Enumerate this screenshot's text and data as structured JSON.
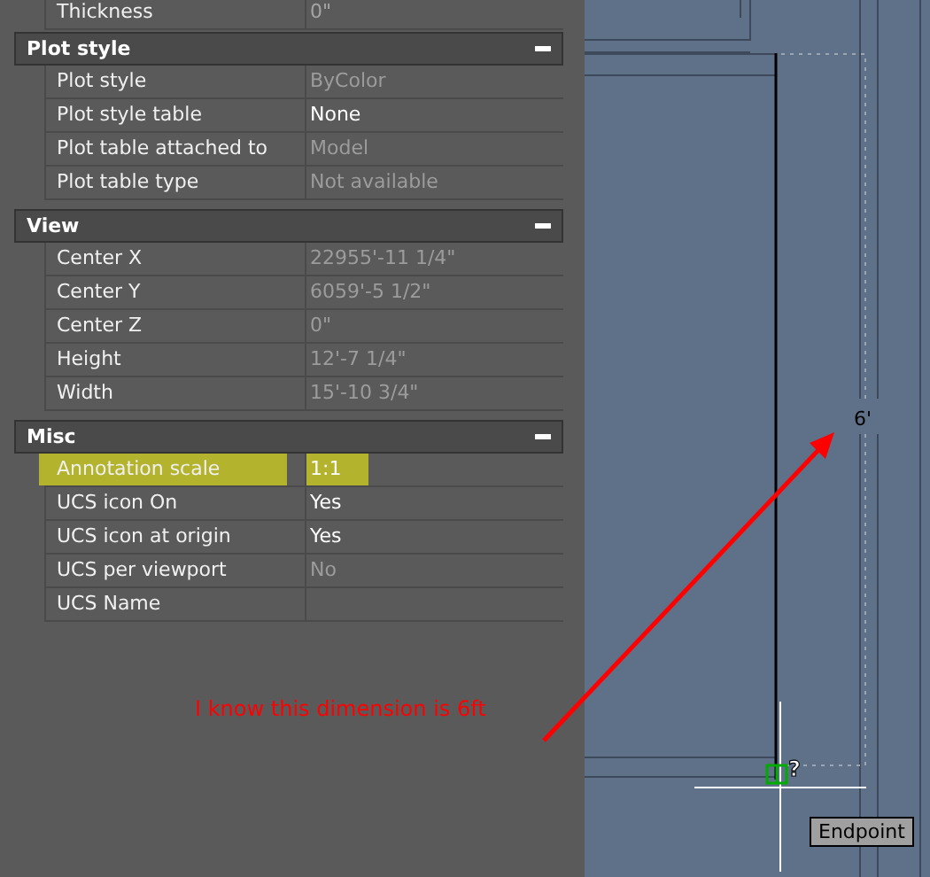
{
  "properties": {
    "partial_row": {
      "label": "Thickness",
      "value": "0\""
    },
    "sections": [
      {
        "title": "Plot style",
        "expanded": true,
        "rows": [
          {
            "label": "Plot style",
            "value": "ByColor",
            "read_only": true,
            "highlighted": false
          },
          {
            "label": "Plot style table",
            "value": "None",
            "read_only": false,
            "highlighted": false
          },
          {
            "label": "Plot table attached to",
            "value": "Model",
            "read_only": true,
            "highlighted": false
          },
          {
            "label": "Plot table type",
            "value": "Not available",
            "read_only": true,
            "highlighted": false
          }
        ]
      },
      {
        "title": "View",
        "expanded": true,
        "rows": [
          {
            "label": "Center X",
            "value": "22955'-11 1/4\"",
            "read_only": true,
            "highlighted": false
          },
          {
            "label": "Center Y",
            "value": "6059'-5 1/2\"",
            "read_only": true,
            "highlighted": false
          },
          {
            "label": "Center Z",
            "value": "0\"",
            "read_only": true,
            "highlighted": false
          },
          {
            "label": "Height",
            "value": "12'-7 1/4\"",
            "read_only": true,
            "highlighted": false
          },
          {
            "label": "Width",
            "value": "15'-10 3/4\"",
            "read_only": true,
            "highlighted": false
          }
        ]
      },
      {
        "title": "Misc",
        "expanded": true,
        "rows": [
          {
            "label": "Annotation scale",
            "value": "1:1",
            "read_only": false,
            "highlighted": true
          },
          {
            "label": "UCS icon On",
            "value": "Yes",
            "read_only": false,
            "highlighted": false
          },
          {
            "label": "UCS icon at origin",
            "value": "Yes",
            "read_only": false,
            "highlighted": false
          },
          {
            "label": "UCS per viewport",
            "value": "No",
            "read_only": true,
            "highlighted": false
          },
          {
            "label": "UCS Name",
            "highlighted": false
          }
        ]
      }
    ]
  },
  "drawing": {
    "dimension_text": "6'",
    "cursor_badge": "?",
    "snap_tooltip": "Endpoint"
  },
  "annotation": {
    "text": "I know this dimension is 6ft"
  }
}
